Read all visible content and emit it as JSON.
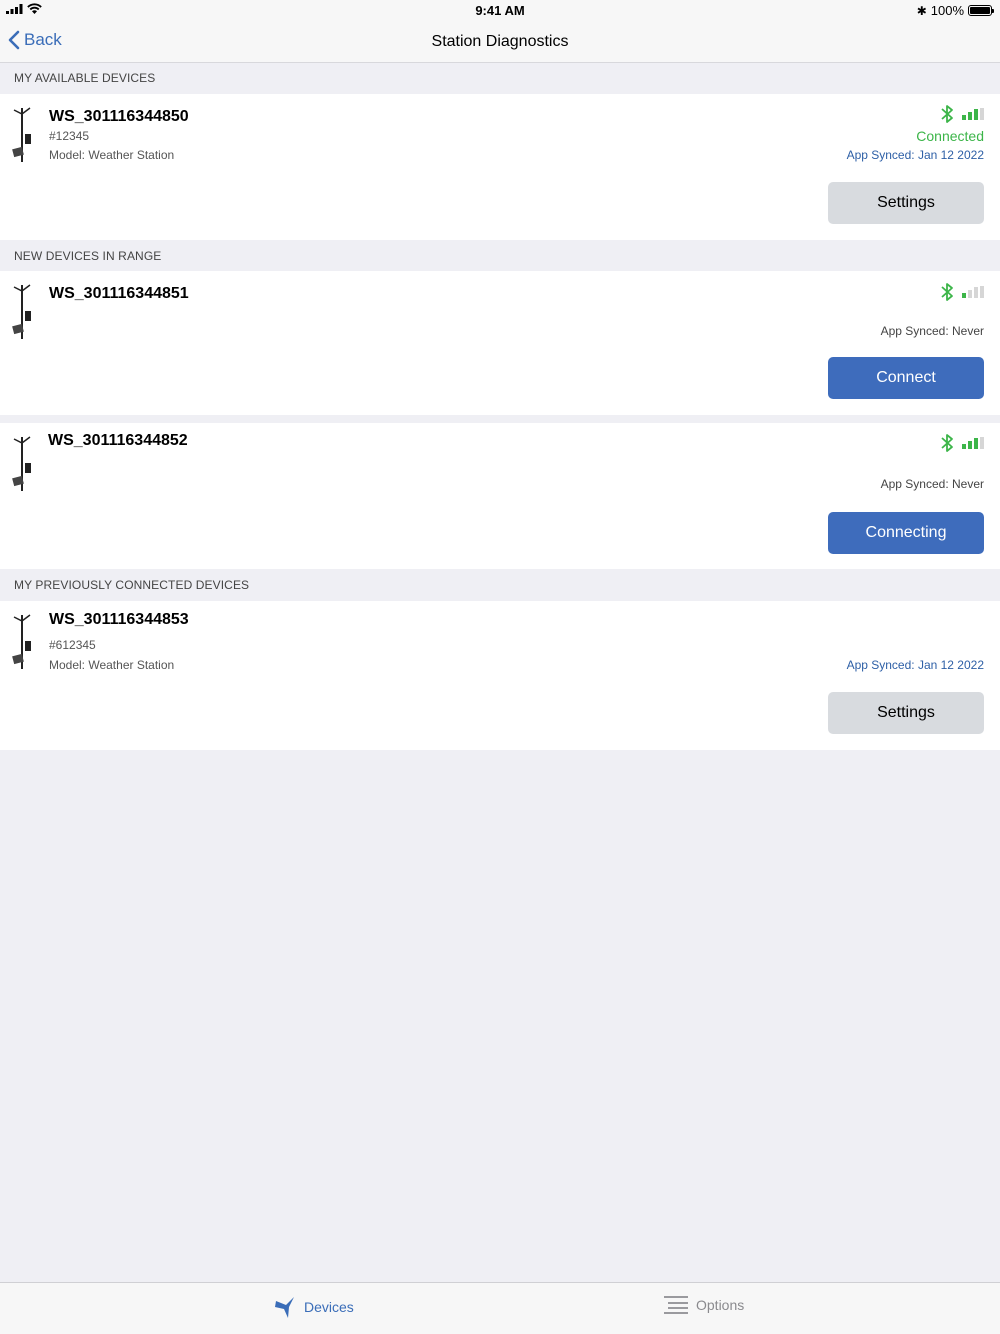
{
  "status_bar": {
    "time": "9:41 AM",
    "battery": "100%"
  },
  "nav": {
    "back_label": "Back",
    "title": "Station Diagnostics"
  },
  "sections": {
    "available": "MY AVAILABLE DEVICES",
    "new_in_range": "NEW DEVICES IN RANGE",
    "previous": "MY PREVIOUSLY CONNECTED DEVICES"
  },
  "devices": [
    {
      "name": "WS_301116344850",
      "id": "#12345",
      "model": "Model: Weather Station",
      "status": "Connected",
      "synced": "App Synced: Jan 12 2022",
      "button": "Settings",
      "signal_bars": 3
    },
    {
      "name": "WS_301116344851",
      "synced": "App Synced: Never",
      "button": "Connect",
      "signal_bars": 1
    },
    {
      "name": "WS_301116344852",
      "synced": "App Synced: Never",
      "button": "Connecting",
      "signal_bars": 3
    },
    {
      "name": "WS_301116344853",
      "id": "#612345",
      "model": "Model: Weather Station",
      "synced": "App Synced: Jan 12 2022",
      "button": "Settings"
    }
  ],
  "tabs": [
    {
      "label": "Devices",
      "icon": "bird-icon",
      "active": true
    },
    {
      "label": "Options",
      "icon": "list-icon",
      "active": false
    }
  ],
  "colors": {
    "accent": "#3e6cbc",
    "connected_green": "#3cb549",
    "sync_blue": "#2d5fa6",
    "background": "#efeff4"
  }
}
